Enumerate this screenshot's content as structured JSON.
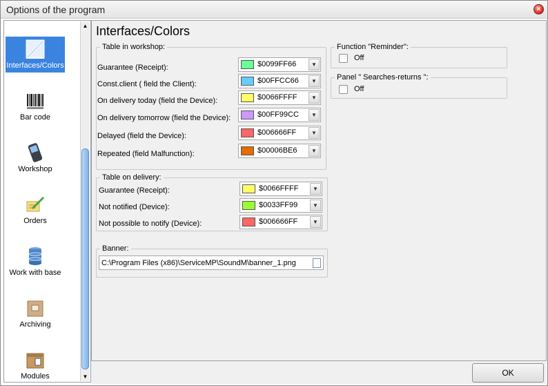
{
  "window": {
    "title": "Options of the program"
  },
  "sidebar": {
    "items": [
      {
        "label": "Interfaces/Colors",
        "icon": "pen-ruler-icon",
        "active": true
      },
      {
        "label": "Bar code",
        "icon": "barcode-icon"
      },
      {
        "label": "Workshop",
        "icon": "mobile-phone-icon"
      },
      {
        "label": "Orders",
        "icon": "orders-pen-icon"
      },
      {
        "label": "Work with base",
        "icon": "database-icon"
      },
      {
        "label": "Archiving",
        "icon": "archive-box-icon"
      },
      {
        "label": "Modules",
        "icon": "modules-box-icon"
      }
    ]
  },
  "main": {
    "title": "Interfaces/Colors",
    "workshop": {
      "legend": "Table in workshop:",
      "rows": [
        {
          "label": "Guarantee (Receipt):",
          "value": "$0099FF66",
          "color": "#66FF99"
        },
        {
          "label": "Const.client ( field the Client):",
          "value": "$00FFCC66",
          "color": "#66CCFF"
        },
        {
          "label": "On delivery today (field the Device):",
          "value": "$0066FFFF",
          "color": "#FFFF66"
        },
        {
          "label": "On delivery tomorrow (field the Device):",
          "value": "$00FF99CC",
          "color": "#CC99FF"
        },
        {
          "label": "Delayed (field the Device):",
          "value": "$006666FF",
          "color": "#FF6666"
        },
        {
          "label": "Repeated (field Malfunction):",
          "value": "$00006BE6",
          "color": "#E66B00"
        }
      ]
    },
    "delivery": {
      "legend": "Table on delivery:",
      "rows": [
        {
          "label": "Guarantee (Receipt):",
          "value": "$0066FFFF",
          "color": "#FFFF66"
        },
        {
          "label": "Not notified (Device):",
          "value": "$0033FF99",
          "color": "#99FF33"
        },
        {
          "label": "Not possible to notify (Device):",
          "value": "$006666FF",
          "color": "#FF6666"
        }
      ]
    },
    "banner": {
      "legend": "Banner:",
      "path": "C:\\Program Files (x86)\\ServiceMP\\SoundM\\banner_1.png"
    },
    "reminder": {
      "legend": "Function \"Reminder\":",
      "checkbox_label": "Off"
    },
    "panel": {
      "legend": "Panel \" Searches-returns \":",
      "checkbox_label": "Off"
    }
  },
  "footer": {
    "ok_label": "OK"
  }
}
